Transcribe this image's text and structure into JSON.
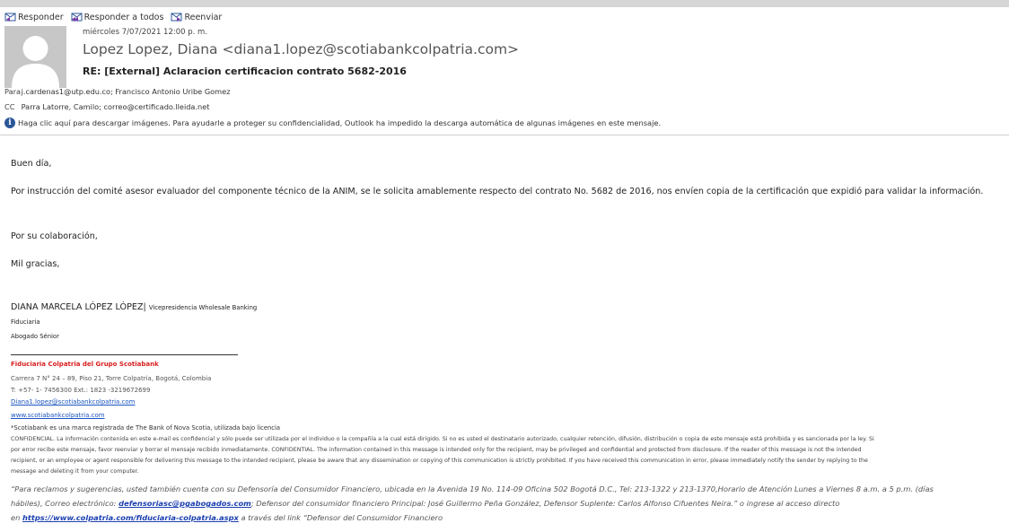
{
  "toolbar": {
    "reply": "Responder",
    "reply_all": "Responder a todos",
    "forward": "Reenviar"
  },
  "message": {
    "date": "miércoles 7/07/2021 12:00 p. m.",
    "sender": "Lopez Lopez, Diana <diana1.lopez@scotiabankcolpatria.com>",
    "subject": "RE: [External] Aclaracion certificacion contrato 5682-2016",
    "to_label": "Para",
    "to": "j.cardenas1@utp.edu.co; Francisco Antonio Uribe Gomez",
    "cc_label": "CC",
    "cc": "Parra Latorre, Camilo; correo@certificado.lleida.net",
    "info_bar": "Haga clic aquí para descargar imágenes. Para ayudarle a proteger su confidencialidad, Outlook ha impedido la descarga automática de algunas imágenes en este mensaje."
  },
  "body": {
    "greeting": "Buen día,",
    "paragraph": "Por instrucción del comité asesor evaluador del componente técnico de la ANIM,  se le solicita amablemente respecto del contrato No. 5682 de 2016, nos envíen copia de la certificación que expidió para validar la información.",
    "thanks1": "Por su colaboración,",
    "thanks2": "Mil gracias,"
  },
  "signature": {
    "name": "DIANA MARCELA LÓPEZ LÓPEZ|",
    "role": "Vicepresidencia Wholesale Banking",
    "line1": "Fiduciaria",
    "line2": "Abogado Sénior",
    "company": "Fiduciaria Colpatria del Grupo Scotiabank",
    "address": "Carrera 7 N° 24 – 89, Piso 21, Torre Colpatria, Bogotá, Colombia",
    "phone": "T: +57- 1- 7456300 Ext.: 1823 -3219672699",
    "email": "Diana1.lopez@scotiabankcolpatria.com",
    "website": "www.scotiabankcolpatria.com"
  },
  "disclaimer": {
    "note": "*Scotiabank es una marca registrada de The Bank of Nova Scotia, utilizada bajo licencia",
    "line1": "CONFIDENCIAL. La información contenida en este e-mail es confidencial y sólo puede ser utilizada por el individuo o la compañía a la cual está dirigido. Si no es usted el destinatario autorizado, cualquier retención, difusión, distribución o copia de este mensaje está prohibida y es sancionada por la ley. Si",
    "line2": "por error recibe este mensaje, favor reenviar y borrar el mensaje recibido inmediatamente. CONFIDENTIAL. The information contained in this message is intended only for the recipient, may be privileged and confidential and protected from disclosure. If the reader of this message is not the intended",
    "line3": "recipient, or an employee or agent responsible for delivering this message to the intended recipient, please be aware that any dissemination or copying of this communication is strictly prohibited. If you have received this communication in error, please immediately notify the sender by replying to the",
    "line4": "message and deleting it from your computer."
  },
  "footer": {
    "line1": "“Para reclamos y sugerencias, usted también cuenta con su Defensoría del Consumidor Financiero, ubicada en la Avenida 19 No. 114-09 Oficina 502 Bogotá D.C., Tel: 213-1322 y 213-1370,Horario de Atención Lunes a Viernes 8 a.m. a 5 p.m. (días",
    "line2_pre": "hábiles), Correo electrónico: ",
    "email_link": "defensoriasc@pgabogados.com",
    "line2_post": "; Defensor del consumidor financiero Principal: José Guillermo Peña González, Defensor Suplente: Carlos Alfonso Cifuentes Neira.” o ingrese al acceso directo",
    "line3_pre": "en ",
    "url_link": "https://www.colpatria.com/fiduciaria-colpatria.aspx",
    "line3_post": " a través del link “Defensor del Consumidor Financiero"
  },
  "colors": {
    "accent": "#2b5797",
    "link": "#1a55c0",
    "company_red": "#d81e1e"
  }
}
